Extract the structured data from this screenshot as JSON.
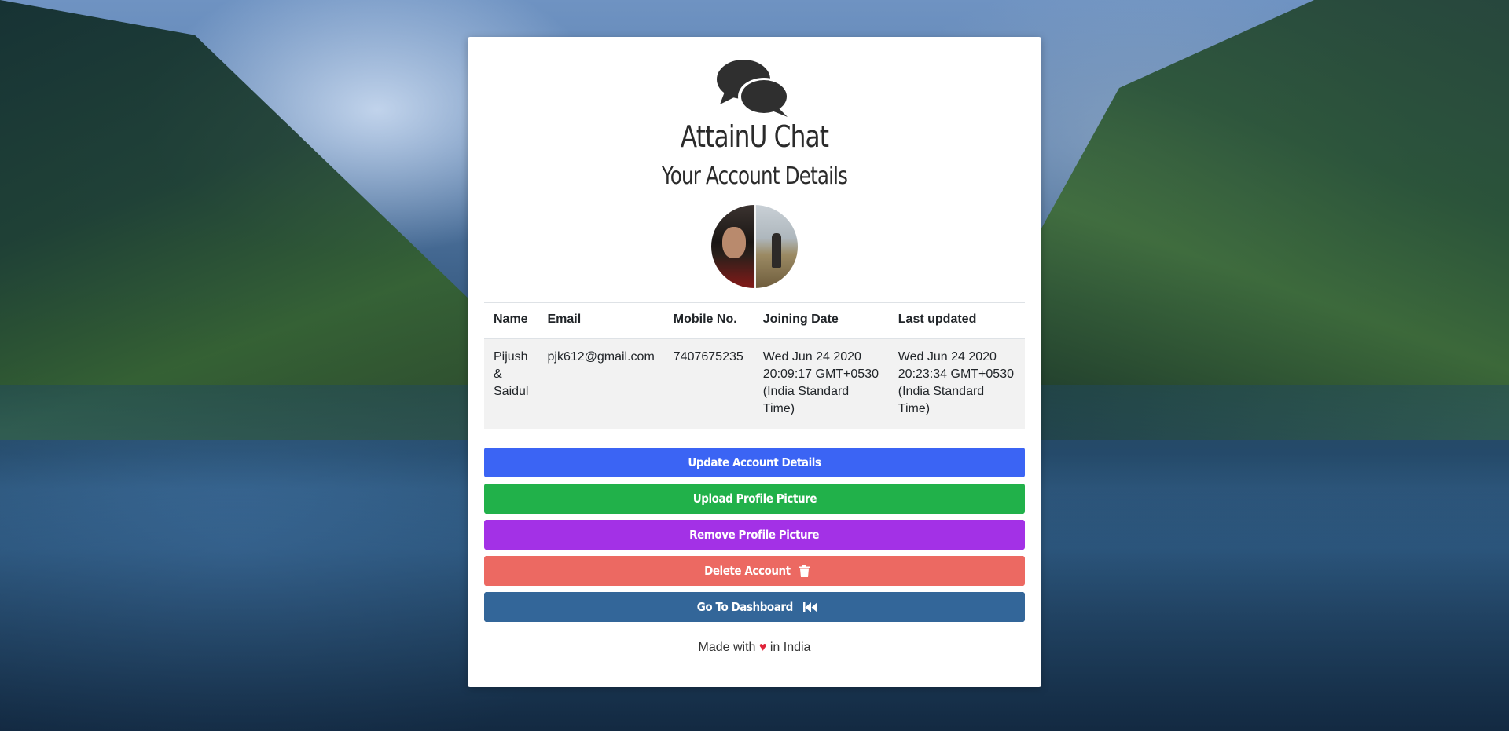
{
  "app": {
    "title": "AttainU Chat",
    "subtitle": "Your Account Details",
    "logo_icon": "comments-icon",
    "avatar_alt": "Profile picture"
  },
  "table": {
    "headers": [
      "Name",
      "Email",
      "Mobile No.",
      "Joining Date",
      "Last updated"
    ],
    "row": {
      "name": "Pijush & Saidul",
      "email": "pjk612@gmail.com",
      "mobile": "7407675235",
      "joining_date": "Wed Jun 24 2020 20:09:17 GMT+0530 (India Standard Time)",
      "last_updated": "Wed Jun 24 2020 20:23:34 GMT+0530 (India Standard Time)"
    }
  },
  "buttons": {
    "update": {
      "label": "Update Account Details",
      "color": "#3b64f4"
    },
    "upload": {
      "label": "Upload Profile Picture",
      "color": "#21b14a"
    },
    "remove": {
      "label": "Remove Profile Picture",
      "color": "#a331e6"
    },
    "delete": {
      "label": "Delete Account",
      "color": "#ec6962",
      "icon": "trash-icon"
    },
    "dashboard": {
      "label": "Go To Dashboard",
      "color": "#336699",
      "icon": "backward-icon"
    }
  },
  "footer": {
    "before": "Made with",
    "heart": "♥",
    "after": "in India"
  }
}
